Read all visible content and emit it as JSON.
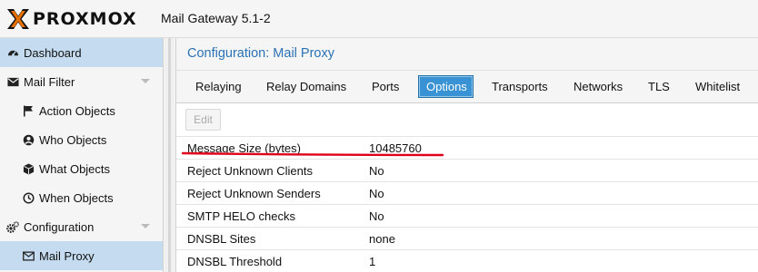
{
  "header": {
    "logo_text": "PROXMOX",
    "product": "Mail Gateway 5.1-2",
    "brand_color": "#e57000"
  },
  "sidebar": {
    "items": [
      {
        "label": "Dashboard",
        "icon": "tachometer-icon",
        "selected": true
      },
      {
        "label": "Mail Filter",
        "icon": "envelope-icon",
        "expandable": true
      },
      {
        "label": "Action Objects",
        "icon": "flag-icon"
      },
      {
        "label": "Who Objects",
        "icon": "user-circle-icon"
      },
      {
        "label": "What Objects",
        "icon": "cube-icon"
      },
      {
        "label": "When Objects",
        "icon": "clock-icon"
      },
      {
        "label": "Configuration",
        "icon": "gears-icon",
        "expandable": true
      },
      {
        "label": "Mail Proxy",
        "icon": "envelope-outline-icon",
        "selected": true
      }
    ]
  },
  "panel": {
    "title": "Configuration: Mail Proxy",
    "tabs": [
      {
        "label": "Relaying"
      },
      {
        "label": "Relay Domains"
      },
      {
        "label": "Ports"
      },
      {
        "label": "Options",
        "active": true
      },
      {
        "label": "Transports"
      },
      {
        "label": "Networks"
      },
      {
        "label": "TLS"
      },
      {
        "label": "Whitelist"
      }
    ],
    "edit_label": "Edit",
    "rows": [
      {
        "name": "Message Size (bytes)",
        "value": "10485760"
      },
      {
        "name": "Reject Unknown Clients",
        "value": "No"
      },
      {
        "name": "Reject Unknown Senders",
        "value": "No"
      },
      {
        "name": "SMTP HELO checks",
        "value": "No"
      },
      {
        "name": "DNSBL Sites",
        "value": "none"
      },
      {
        "name": "DNSBL Threshold",
        "value": "1"
      }
    ],
    "accent_color": "#3892d4",
    "highlight_color": "#e0001a"
  }
}
